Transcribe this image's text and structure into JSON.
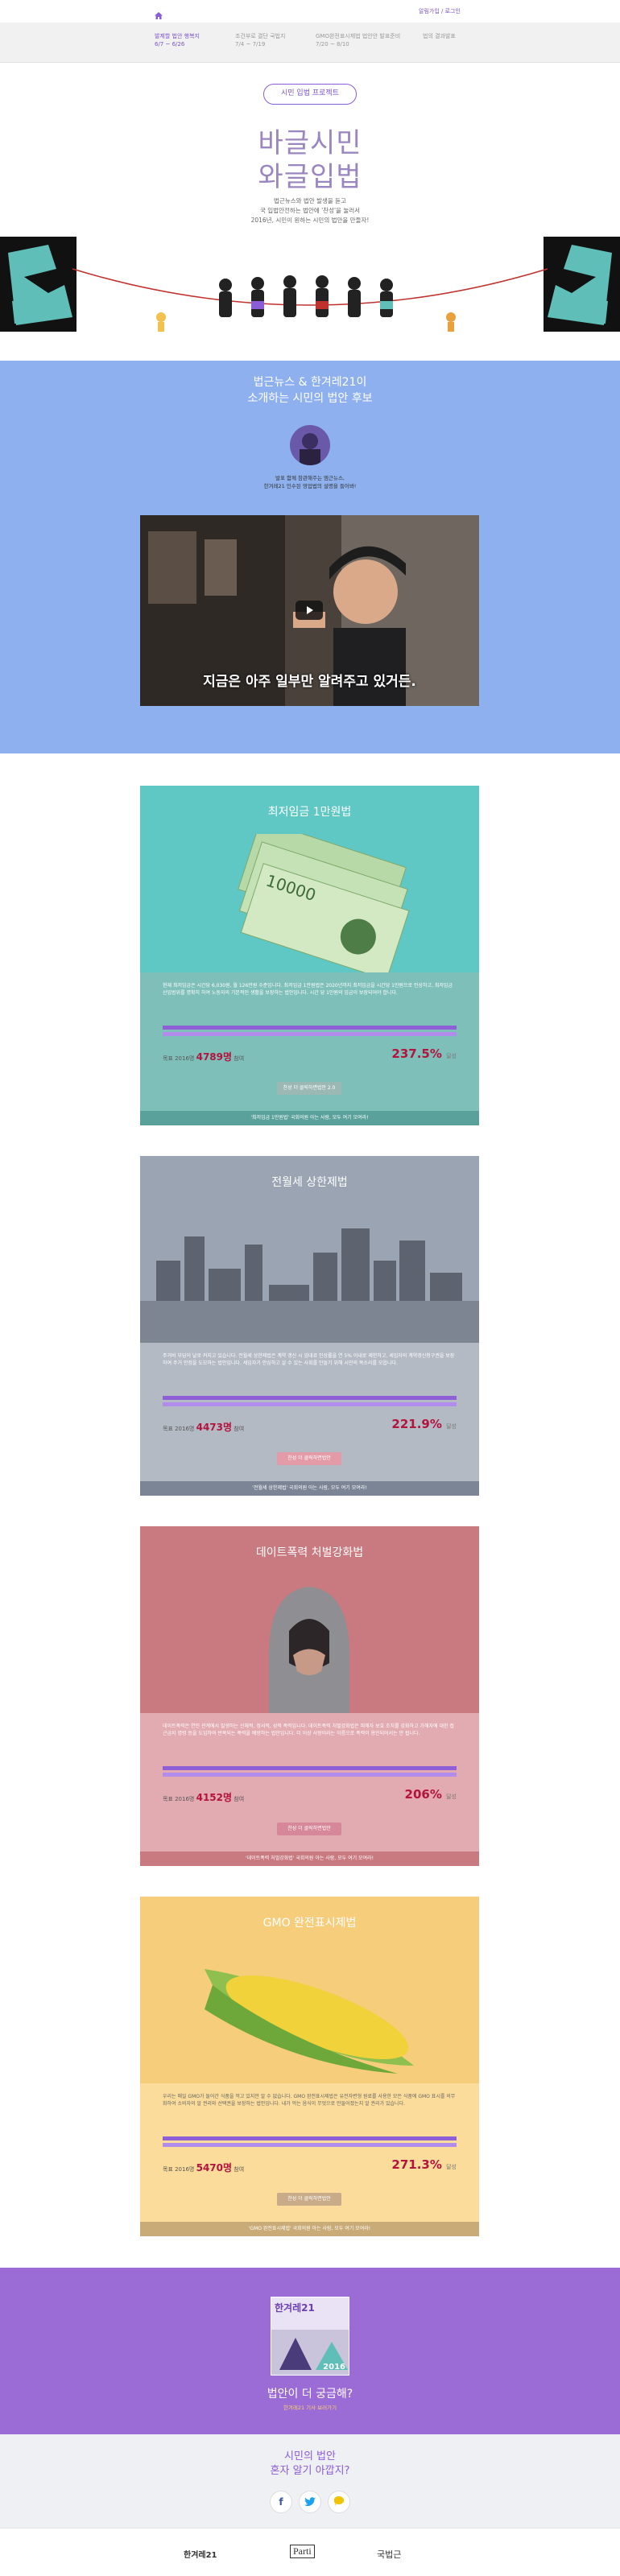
{
  "topbar": {
    "home_icon": "home-icon",
    "login_label": "알림가입 / 로그인"
  },
  "tabs": [
    {
      "title": "발제할 법안 행복지",
      "date": "6/7 ~ 6/26"
    },
    {
      "title": "조건부로 결단 국법지",
      "date": "7/4 ~ 7/19"
    },
    {
      "title": "GMO완전표시제법 법안안 발표준비",
      "date": "7/20 ~ 8/10"
    },
    {
      "title": "법의 결과발표",
      "date": ""
    }
  ],
  "hero": {
    "pill": "시민 입법 프로젝트",
    "title_line1": "바글시민",
    "title_line2": "와글입법",
    "intro_line1": "법근뉴스와 법안 발생을 듣고",
    "intro_line2": "국 입법안전하는 법안에 '찬성'을 눌러서",
    "intro_line3": "2016년, 시민이 원하는 시민의 법안을 만들자!"
  },
  "video_section": {
    "title_line1": "법근뉴스 & 한겨레21이",
    "title_line2": "소개하는 시민의 법안 후보",
    "caption_line1": "발표 함께 참관해주는 엠근뉴스,",
    "caption_line2": "한겨레21 인수된 영업법의 설명을 들어봐!",
    "subtitle": "지금은 아주 일부만 알려주고 있거든."
  },
  "cards": [
    {
      "title": "최저임금 1만원법",
      "desc": "현재 최저임금은 시간당 6,030원, 월 126만원 수준입니다. 최저임금 1만원법은 2020년까지 최저임금을 시간당 1만원으로 인상하고, 최저임금 산입범위를 명확히 하여 노동자의 기본적인 생활을 보장하는 법안입니다. 시간 당 1만원의 임금이 보장되어야 합니다.",
      "goal_label": "목표 2016명",
      "count": "4789명",
      "count_suffix": "참여",
      "pct": "237.5%",
      "pct_suffix": "달성",
      "btn": "찬성 더 클릭하면법안 2.0",
      "foot": "'최저임금 1만원법' 국회의원 아는 사람, 모두 여기 모여라!",
      "progress": 1.0
    },
    {
      "title": "전월세 상한제법",
      "desc": "주거비 부담이 날로 커지고 있습니다. 전월세 상한제법은 계약 갱신 시 임대료 인상률을 연 5% 이내로 제한하고, 세입자의 계약갱신청구권을 보장하여 주거 안정을 도모하는 법안입니다. 세입자가 안심하고 살 수 있는 사회를 만들기 위해 시민의 목소리를 모읍니다.",
      "goal_label": "목표 2016명",
      "count": "4473명",
      "count_suffix": "참여",
      "pct": "221.9%",
      "pct_suffix": "달성",
      "btn": "찬성 더 클릭하면법안",
      "foot": "'전월세 상한제법' 국회의원 아는 사람, 모두 여기 모여라!",
      "progress": 1.0
    },
    {
      "title": "데이트폭력 처벌강화법",
      "desc": "데이트폭력은 연인 관계에서 발생하는 신체적, 정서적, 성적 폭력입니다. 데이트폭력 처벌강화법은 피해자 보호 조치를 강화하고 가해자에 대한 접근금지 명령 등을 도입하여 반복되는 폭력을 예방하는 법안입니다. 더 이상 사랑이라는 이름으로 폭력이 용인되어서는 안 됩니다.",
      "goal_label": "목표 2016명",
      "count": "4152명",
      "count_suffix": "참여",
      "pct": "206%",
      "pct_suffix": "달성",
      "btn": "찬성 더 클릭하면법안",
      "foot": "'데이트폭력 처벌강화법' 국회의원 아는 사람, 모두 여기 모여라!",
      "progress": 1.0
    },
    {
      "title": "GMO 완전표시제법",
      "desc": "우리는 매일 GMO가 들어간 식품을 먹고 있지만 알 수 없습니다. GMO 완전표시제법은 유전자변형 원료를 사용한 모든 식품에 GMO 표시를 의무화하여 소비자의 알 권리와 선택권을 보장하는 법안입니다. 내가 먹는 음식이 무엇으로 만들어졌는지 알 권리가 있습니다.",
      "goal_label": "목표 2016명",
      "count": "5470명",
      "count_suffix": "참여",
      "pct": "271.3%",
      "pct_suffix": "달성",
      "btn": "찬성 더 클릭하면법안",
      "foot": "'GMO 완전표시제법' 국회의원 아는 사람, 모두 여기 모여라!",
      "progress": 1.0
    }
  ],
  "magazine": {
    "cover_title": "한겨레21",
    "cover_year": "2016",
    "question": "법안이 더 궁금해?",
    "link": "한겨레21 기사 보러가기"
  },
  "share": {
    "line1": "시민의 법안",
    "line2": "혼자 알기 아깝지?",
    "icons": [
      "facebook-icon",
      "twitter-icon",
      "kakao-icon"
    ]
  },
  "footer": {
    "logo1": "한겨레21",
    "logo2": "Parti",
    "logo3": "국법근"
  },
  "colors": {
    "accent": "#8a5cd6",
    "card1": "#5fc8c4",
    "card2": "#9aa4b3",
    "card3": "#c97a80",
    "card4": "#f6cd7a",
    "progress": "#8e5fd6",
    "red": "#b3143e"
  }
}
